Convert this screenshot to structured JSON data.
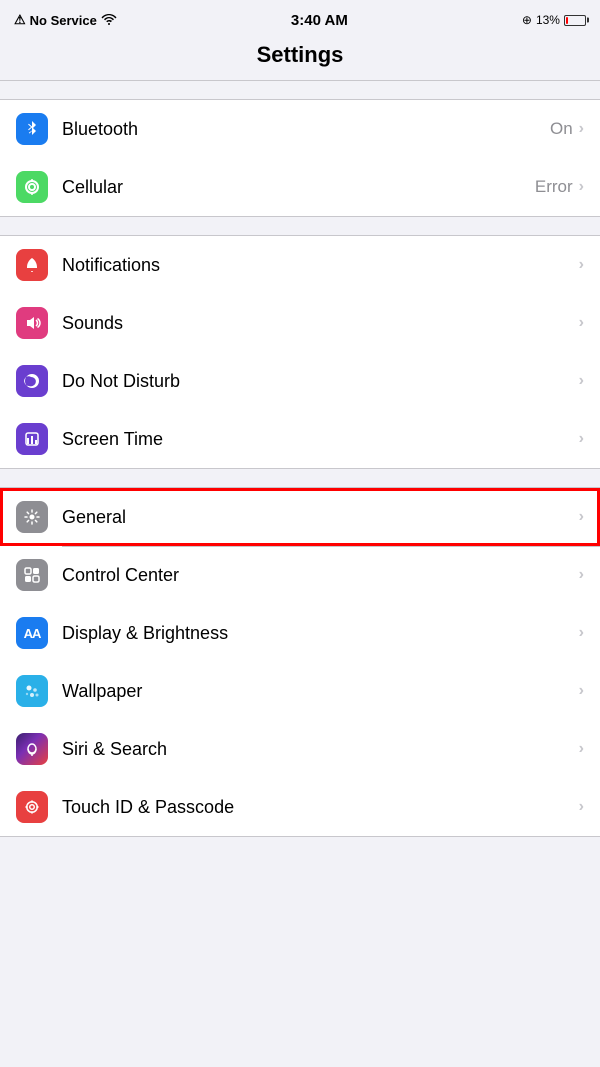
{
  "statusBar": {
    "signal": "No Service",
    "time": "3:40 AM",
    "batteryPercent": "13%",
    "batteryLevel": 13
  },
  "pageTitle": "Settings",
  "sections": [
    {
      "id": "connectivity",
      "rows": [
        {
          "id": "bluetooth",
          "label": "Bluetooth",
          "value": "On",
          "iconClass": "icon-bluetooth",
          "iconSymbol": "bluetooth"
        },
        {
          "id": "cellular",
          "label": "Cellular",
          "value": "Error",
          "iconClass": "icon-cellular",
          "iconSymbol": "cellular"
        }
      ]
    },
    {
      "id": "alerts",
      "rows": [
        {
          "id": "notifications",
          "label": "Notifications",
          "value": "",
          "iconClass": "icon-notifications",
          "iconSymbol": "notifications"
        },
        {
          "id": "sounds",
          "label": "Sounds",
          "value": "",
          "iconClass": "icon-sounds",
          "iconSymbol": "sounds"
        },
        {
          "id": "dnd",
          "label": "Do Not Disturb",
          "value": "",
          "iconClass": "icon-dnd",
          "iconSymbol": "dnd"
        },
        {
          "id": "screentime",
          "label": "Screen Time",
          "value": "",
          "iconClass": "icon-screentime",
          "iconSymbol": "screentime"
        }
      ]
    },
    {
      "id": "system",
      "rows": [
        {
          "id": "general",
          "label": "General",
          "value": "",
          "iconClass": "icon-general",
          "iconSymbol": "general",
          "highlighted": true
        },
        {
          "id": "controlcenter",
          "label": "Control Center",
          "value": "",
          "iconClass": "icon-control",
          "iconSymbol": "control"
        },
        {
          "id": "display",
          "label": "Display & Brightness",
          "value": "",
          "iconClass": "icon-display",
          "iconSymbol": "display"
        },
        {
          "id": "wallpaper",
          "label": "Wallpaper",
          "value": "",
          "iconClass": "icon-wallpaper",
          "iconSymbol": "wallpaper"
        },
        {
          "id": "siri",
          "label": "Siri & Search",
          "value": "",
          "iconClass": "icon-siri",
          "iconSymbol": "siri"
        },
        {
          "id": "touchid",
          "label": "Touch ID & Passcode",
          "value": "",
          "iconClass": "icon-touchid",
          "iconSymbol": "touchid"
        }
      ]
    }
  ],
  "icons": {
    "bluetooth": "❄",
    "cellular": "📶",
    "notifications": "🔔",
    "sounds": "🔊",
    "dnd": "🌙",
    "screentime": "⏳",
    "general": "⚙",
    "control": "⚙",
    "display": "AA",
    "wallpaper": "✿",
    "siri": "◉",
    "touchid": "☎"
  }
}
